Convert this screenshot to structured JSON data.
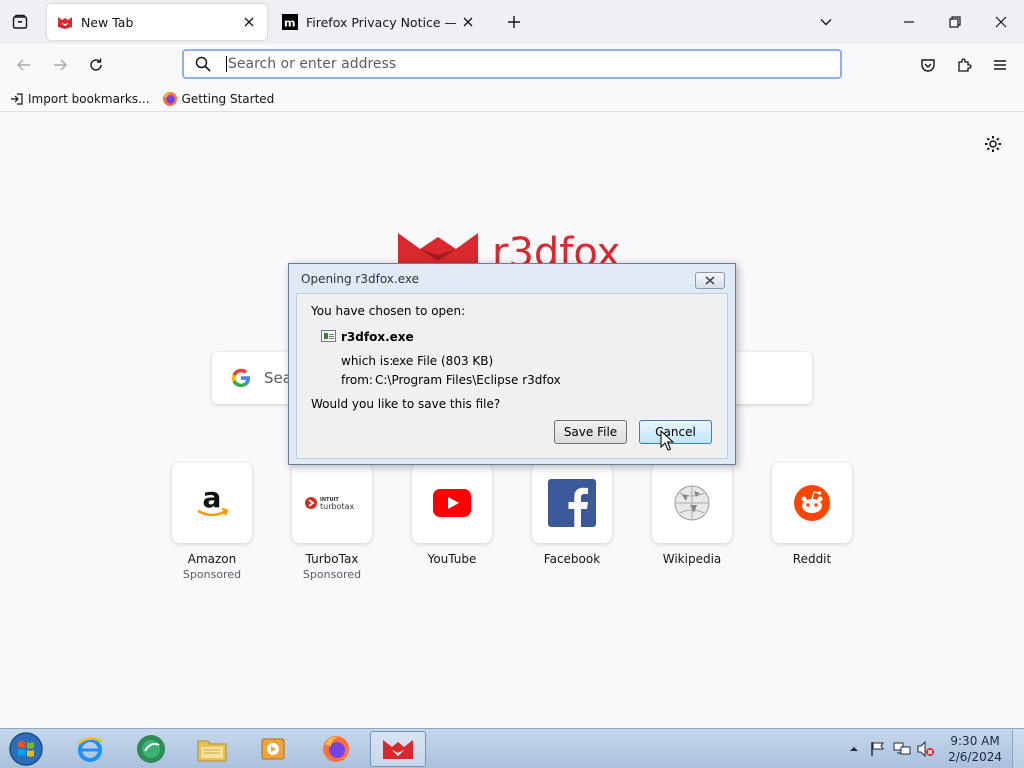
{
  "tabs": [
    {
      "title": "New Tab",
      "icon": "r3dfox-icon",
      "active": true
    },
    {
      "title": "Firefox Privacy Notice — Mozilla",
      "icon": "mozilla-icon",
      "active": false
    }
  ],
  "navbar": {
    "search_placeholder": "Search or enter address"
  },
  "bookmarks": [
    {
      "label": "Import bookmarks...",
      "icon": "import-icon"
    },
    {
      "label": "Getting Started",
      "icon": "firefox-icon"
    }
  ],
  "newtab": {
    "brand_wordmark": "r3dfox",
    "search_placeholder": "Search",
    "tiles": [
      {
        "label": "Amazon",
        "sponsor": "Sponsored"
      },
      {
        "label": "TurboTax",
        "sponsor": "Sponsored",
        "logo_top": "INTUIT",
        "logo_bottom": "turbotax"
      },
      {
        "label": "YouTube",
        "sponsor": ""
      },
      {
        "label": "Facebook",
        "sponsor": ""
      },
      {
        "label": "Wikipedia",
        "sponsor": ""
      },
      {
        "label": "Reddit",
        "sponsor": ""
      }
    ]
  },
  "dialog": {
    "title": "Opening r3dfox.exe",
    "intro": "You have chosen to open:",
    "filename": "r3dfox.exe",
    "which_is_label": "which is:",
    "which_is_value": "exe File (803 KB)",
    "from_label": "from:",
    "from_value": "C:\\Program Files\\Eclipse r3dfox",
    "question": "Would you like to save this file?",
    "save_label": "Save File",
    "cancel_label": "Cancel"
  },
  "taskbar": {
    "time": "9:30 AM",
    "date": "2/6/2024",
    "apps": [
      "internet-explorer-icon",
      "media-center-icon",
      "file-explorer-icon",
      "media-player-icon",
      "firefox-icon",
      "r3dfox-icon"
    ]
  },
  "colors": {
    "accent": "#0061e0",
    "brand_red": "#d9282e",
    "dialog_bg": "#dfeaf6"
  }
}
